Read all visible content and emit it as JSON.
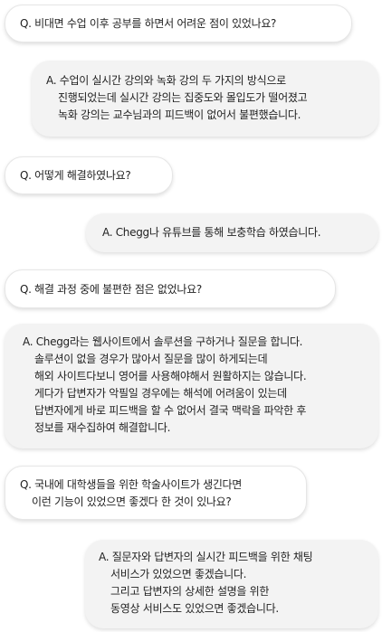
{
  "messages": [
    {
      "role": "question",
      "lines": [
        "Q. 비대면 수업 이후 공부를 하면서 어려운 점이 있었나요?"
      ]
    },
    {
      "role": "answer",
      "lines": [
        "A. 수업이 실시간 강의와 녹화 강의 두 가지의 방식으로",
        "진행되었는데 실시간 강의는 집중도와 몰입도가 떨어졌고",
        "녹화 강의는 교수님과의 피드백이 없어서 불편했습니다."
      ]
    },
    {
      "role": "question",
      "lines": [
        "Q. 어떻게 해결하였나요?"
      ]
    },
    {
      "role": "answer",
      "lines": [
        "A. Chegg나 유튜브를 통해 보충학습 하였습니다."
      ]
    },
    {
      "role": "question",
      "lines": [
        "Q. 해결 과정 중에 불편한 점은 없었나요?"
      ]
    },
    {
      "role": "answer",
      "lines": [
        "A. Chegg라는 웹사이트에서 솔루션을 구하거나 질문을 합니다.",
        "솔루션이 없을 경우가 많아서 질문을 많이 하게되는데",
        "해외 사이트다보니 영어를 사용해야해서 원활하지는 않습니다.",
        "게다가 답변자가 악필일 경우에는 해석에 어려움이 있는데",
        "답변자에게 바로 피드백을 할 수 없어서 결국 맥락을 파악한 후",
        "정보를 재수집하여 해결합니다."
      ]
    },
    {
      "role": "question",
      "lines": [
        "Q. 국내에 대학생들을 위한 학술사이트가 생긴다면",
        "이런 기능이 있었으면 좋겠다 한 것이 있나요?"
      ]
    },
    {
      "role": "answer",
      "lines": [
        "A. 질문자와 답변자의 실시간 피드백을 위한 채팅",
        "서비스가 있었으면 좋겠습니다.",
        "그리고 답변자의 상세한 설명을 위한",
        "동영상 서비스도 있었으면 좋겠습니다."
      ]
    }
  ]
}
